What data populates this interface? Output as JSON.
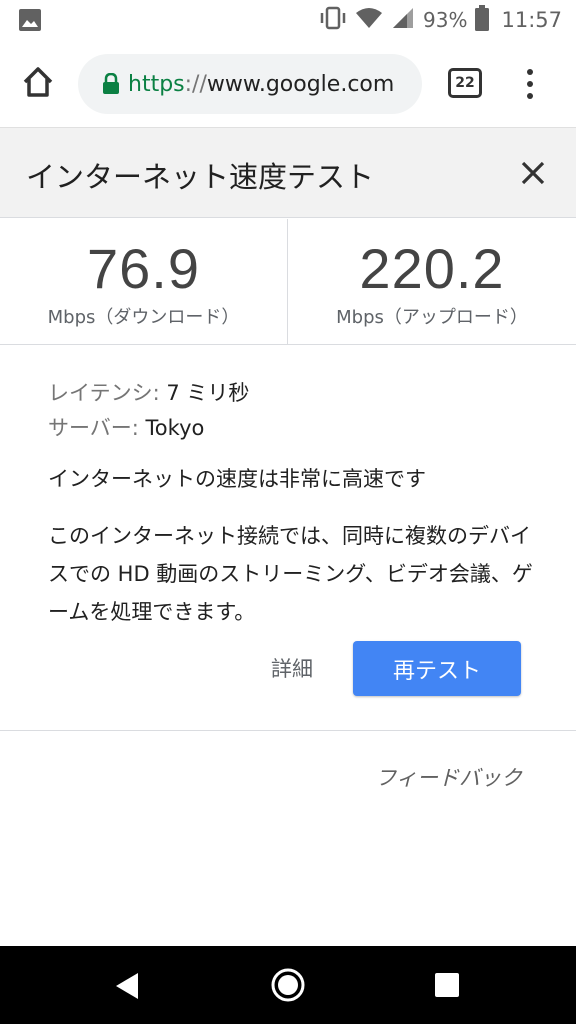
{
  "status_bar": {
    "battery_percent": "93%",
    "time": "11:57"
  },
  "browser": {
    "url_scheme": "https",
    "url_separator": "://",
    "url_host": "www.google.com",
    "tab_count": "22"
  },
  "speed_test": {
    "title": "インターネット速度テスト",
    "download": {
      "value": "76.9",
      "unit": "Mbps（ダウンロード）"
    },
    "upload": {
      "value": "220.2",
      "unit": "Mbps（アップロード）"
    },
    "latency_label": "レイテンシ: ",
    "latency_value": "7 ミリ秒",
    "server_label": "サーバー: ",
    "server_value": "Tokyo",
    "summary": "インターネットの速度は非常に高速です",
    "description": "このインターネット接続では、同時に複数のデバイスでの HD 動画のストリーミング、ビデオ会議、ゲームを処理できます。",
    "details_label": "詳細",
    "retest_label": "再テスト",
    "feedback_label": "フィードバック"
  },
  "colors": {
    "accent_blue": "#4285f4",
    "secure_green": "#0b8043",
    "header_bg": "#f2f2f2"
  }
}
